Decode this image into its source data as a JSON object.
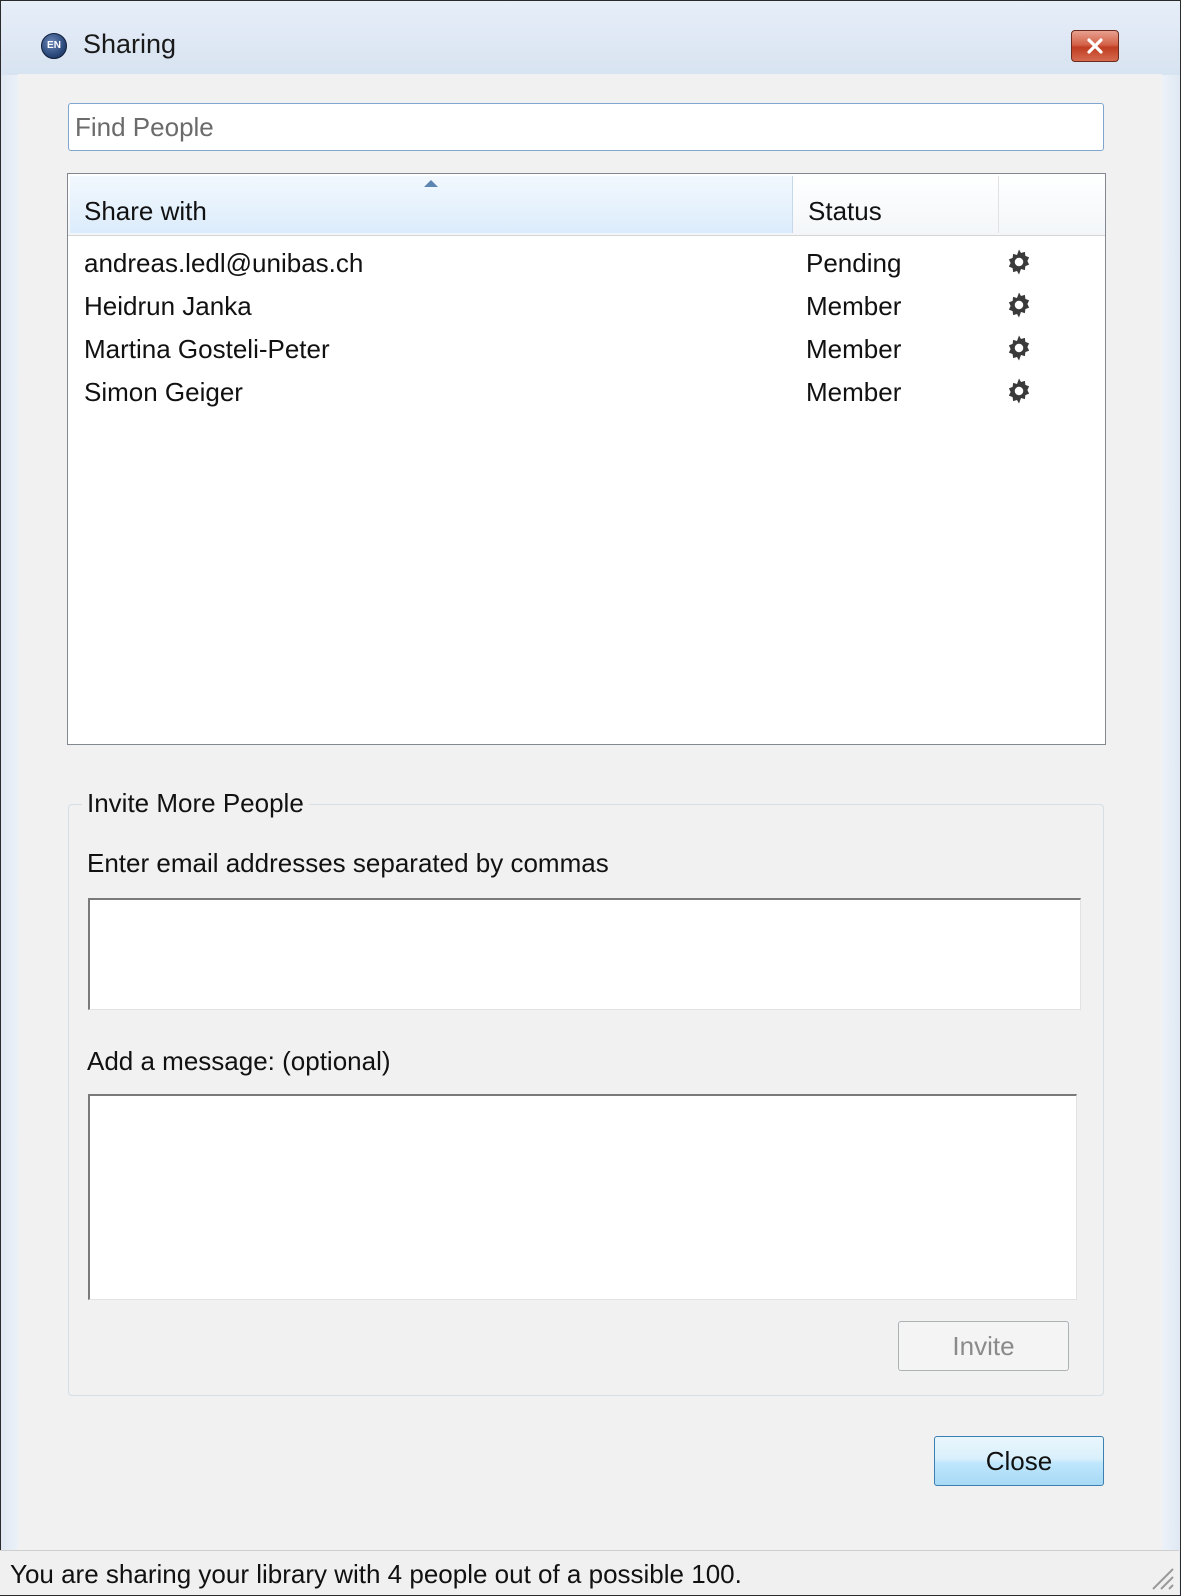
{
  "window": {
    "title": "Sharing",
    "icon": "app-logo-icon"
  },
  "search": {
    "placeholder": "Find People",
    "value": ""
  },
  "table": {
    "columns": [
      "Share with",
      "Status",
      ""
    ],
    "sorted_column": "Share with",
    "sort_direction": "ascending",
    "rows": [
      {
        "name": "andreas.ledl@unibas.ch",
        "status": "Pending",
        "action_icon": "gear-icon"
      },
      {
        "name": "Heidrun Janka",
        "status": "Member",
        "action_icon": "gear-icon"
      },
      {
        "name": "Martina Gosteli-Peter",
        "status": "Member",
        "action_icon": "gear-icon"
      },
      {
        "name": "Simon Geiger",
        "status": "Member",
        "action_icon": "gear-icon"
      }
    ]
  },
  "invite": {
    "group_title": "Invite More People",
    "emails_label": "Enter email addresses separated by commas",
    "emails_value": "",
    "message_label": "Add a message: (optional)",
    "message_value": "",
    "invite_button": "Invite",
    "invite_enabled": false
  },
  "footer": {
    "close_button": "Close",
    "status_text": "You are sharing your library with 4 people out of a possible 100."
  },
  "colors": {
    "close_x": "#c9452b",
    "header_sorted": "#dcecfc",
    "close_button_border": "#3c7fb1"
  }
}
